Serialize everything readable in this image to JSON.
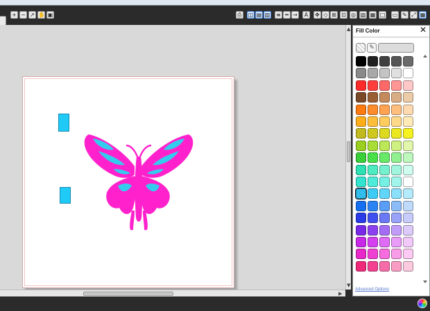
{
  "panel": {
    "title": "Fill Color",
    "advanced_label": "Advanced Options",
    "swatch_rows": [
      [
        "#000000",
        "#202020",
        "#404040",
        "#555555",
        "#6a6a6a"
      ],
      [
        "#8a8a8a",
        "#a8a8a8",
        "#c4c4c4",
        "#e0e0e0",
        "#ffffff"
      ],
      [
        "#ff2a2a",
        "#ff3d3d",
        "#ff6868",
        "#ff9696",
        "#ffc8c8"
      ],
      [
        "#7a4a28",
        "#9a5e34",
        "#c48a5c",
        "#d8ac84",
        "#eccca8"
      ],
      [
        "#ff7a10",
        "#ff8c2a",
        "#ffa352",
        "#ffbe7e",
        "#ffd9b0"
      ],
      [
        "#ffae1a",
        "#ffbe3a",
        "#ffcc5e",
        "#ffd98a",
        "#ffeab8"
      ],
      [
        "#b8b000",
        "#c8c000",
        "#d8d400",
        "#e8e400",
        "#f4f000"
      ],
      [
        "#8cc800",
        "#9cd81a",
        "#b2e440",
        "#c8ee6e",
        "#def6a0"
      ],
      [
        "#1ec81e",
        "#2edb2e",
        "#52e652",
        "#80ee80",
        "#b4f6b4"
      ],
      [
        "#10dca8",
        "#34e8b8",
        "#62eec8",
        "#94f4da",
        "#c8fcec"
      ],
      [
        "#16e0c8",
        "#36e8d4",
        "#62eee0",
        "#94f4e8",
        "#ffffff"
      ],
      [
        "#14b4e8",
        "#20c4f4",
        "#4ad0f8",
        "#7adcfa",
        "#aae8fc"
      ],
      [
        "#1470f0",
        "#2c84f4",
        "#5a9ef6",
        "#8cbcf8",
        "#c0dafc"
      ],
      [
        "#2a3ce8",
        "#4050f0",
        "#6a78f4",
        "#98a2f6",
        "#c8ccfa"
      ],
      [
        "#7a28e8",
        "#8c40f0",
        "#a46cf4",
        "#c09cf8",
        "#dccafa"
      ],
      [
        "#c828e8",
        "#d440f0",
        "#de6cf4",
        "#e89cf8",
        "#f2cafa"
      ],
      [
        "#e828c8",
        "#f040d4",
        "#f46cde",
        "#f89ce8",
        "#fccaf2"
      ],
      [
        "#f0287a",
        "#f44090",
        "#f66ca8",
        "#f89cc4",
        "#fccade"
      ]
    ],
    "selected": [
      11,
      0
    ]
  },
  "canvas": {
    "butterfly_body_color": "#ff22cc",
    "butterfly_accent_color": "#33ccee",
    "rect_color": "#1fcaf6"
  },
  "toolbar": {
    "left_icons": [
      "zoom-in-icon",
      "zoom-out-icon",
      "pan-icon",
      "hand-icon",
      "fit-page-icon"
    ],
    "right_icons": [
      "printer-icon",
      "view-icon",
      "layout-icon",
      "panel-icon",
      "line-icon",
      "line-style-icon",
      "arrow-icon",
      "text-icon",
      "node-icon",
      "shape-icon",
      "weld-icon",
      "group-icon",
      "layers-icon",
      "fill-icon",
      "stroke-icon",
      "page-icon",
      "pencil-icon",
      "expand-icon",
      "grid-icon"
    ]
  }
}
